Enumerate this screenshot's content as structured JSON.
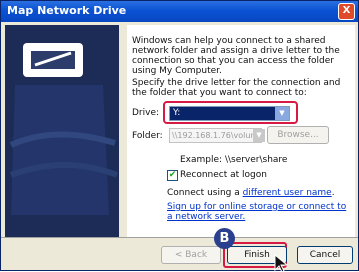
{
  "window": {
    "title": "Map Network Drive",
    "close_glyph": "X"
  },
  "intro_text": "Windows can help you connect to a shared network folder and assign a drive letter to the connection so that you can access the folder using My Computer.",
  "specify_text": "Specify the drive letter for the connection and the folder that you want to connect to:",
  "drive": {
    "label": "Drive:",
    "value": "Y:"
  },
  "folder": {
    "label": "Folder:",
    "value": "\\\\192.168.1.76\\volume1",
    "browse_label": "Browse..."
  },
  "example_text": "Example: \\\\server\\share",
  "reconnect": {
    "label": "Reconnect at logon",
    "checked": true
  },
  "connect_as": {
    "prefix": "Connect using a ",
    "link": "different user name",
    "suffix": "."
  },
  "signup_link": "Sign up for online storage or connect to a network server.",
  "buttons": {
    "back": "< Back",
    "finish": "Finish",
    "cancel": "Cancel"
  },
  "annotation_marker": "B",
  "colors": {
    "titlebar": "#0a52d4",
    "highlight": "#d61a44",
    "marker": "#2b3f8f"
  }
}
